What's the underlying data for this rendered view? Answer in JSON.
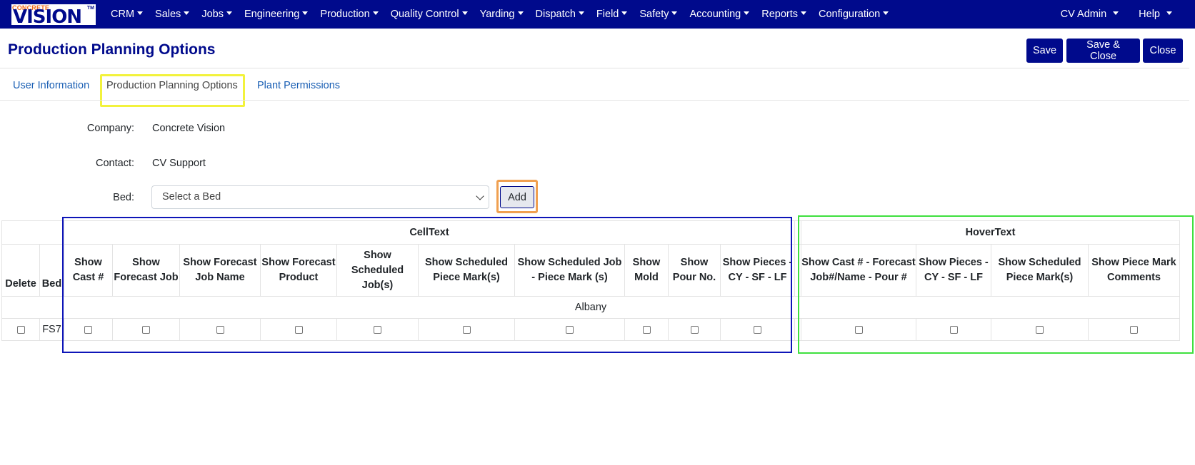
{
  "nav": {
    "logo_small": "CONCRETE",
    "logo_main": "VISION",
    "logo_tm": "TM",
    "items": [
      "CRM",
      "Sales",
      "Jobs",
      "Engineering",
      "Production",
      "Quality Control",
      "Yarding",
      "Dispatch",
      "Field",
      "Safety",
      "Accounting",
      "Reports",
      "Configuration"
    ],
    "user": "CV Admin",
    "help": "Help"
  },
  "header": {
    "title": "Production Planning Options",
    "save": "Save",
    "save_close": "Save & Close",
    "close": "Close"
  },
  "tabs": {
    "user_info": "User Information",
    "prod_planning": "Production Planning Options",
    "plant_permissions": "Plant Permissions"
  },
  "form": {
    "company_label": "Company:",
    "company_value": "Concrete Vision",
    "contact_label": "Contact:",
    "contact_value": "CV Support",
    "bed_label": "Bed:",
    "bed_placeholder": "Select a Bed",
    "add_label": "Add"
  },
  "table": {
    "group_celltext": "CellText",
    "group_hovertext": "HoverText",
    "col_delete": "Delete",
    "col_bed": "Bed",
    "celltext_cols": [
      "Show Cast #",
      "Show Forecast Job",
      "Show Forecast Job Name",
      "Show Forecast Product",
      "Show Scheduled Job(s)",
      "Show Scheduled Piece Mark(s)",
      "Show Scheduled Job - Piece Mark (s)",
      "Show Mold",
      "Show Pour No.",
      "Show Pieces - CY - SF - LF"
    ],
    "hovertext_cols": [
      "Show Cast # - Forecast Job#/Name - Pour #",
      "Show Pieces - CY - SF - LF",
      "Show Scheduled Piece Mark(s)",
      "Show Piece Mark Comments"
    ],
    "group_row": "Albany",
    "rows": [
      {
        "bed": "FS7"
      }
    ]
  }
}
